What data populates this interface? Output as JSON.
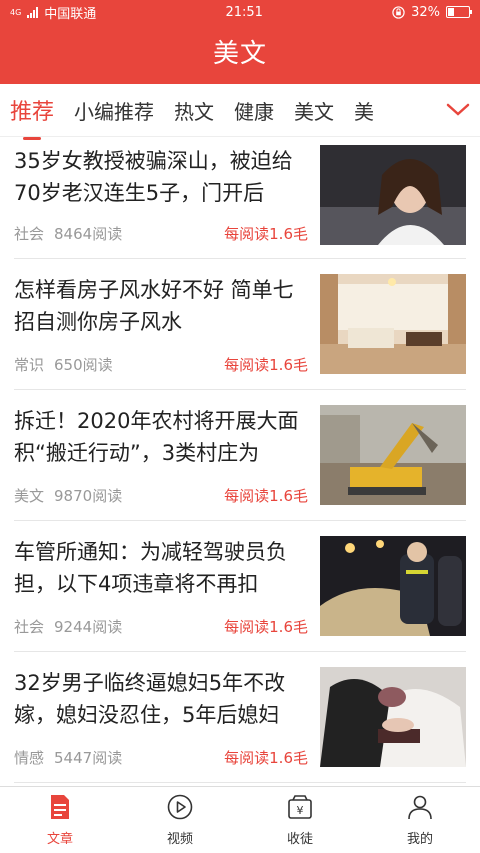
{
  "status": {
    "network_tag": "4G",
    "carrier": "中国联通",
    "time": "21:51",
    "battery_text": "32%",
    "battery_level": 0.32
  },
  "header": {
    "title": "美文"
  },
  "tabs": [
    {
      "label": "推荐",
      "active": true
    },
    {
      "label": "小编推荐"
    },
    {
      "label": "热文"
    },
    {
      "label": "健康"
    },
    {
      "label": "美文"
    },
    {
      "label": "美"
    }
  ],
  "articles": [
    {
      "title": "35岁女教授被骗深山，被迫给70岁老汉连生5子，门开后",
      "category": "社会",
      "reads": "8464阅读",
      "reward": "每阅读1.6毛"
    },
    {
      "title": "怎样看房子风水好不好 简单七招自测你房子风水",
      "category": "常识",
      "reads": "650阅读",
      "reward": "每阅读1.6毛"
    },
    {
      "title": "拆迁！2020年农村将开展大面积“搬迁行动”，3类村庄为",
      "category": "美文",
      "reads": "9870阅读",
      "reward": "每阅读1.6毛"
    },
    {
      "title": "车管所通知：为减轻驾驶员负担，以下4项违章将不再扣",
      "category": "社会",
      "reads": "9244阅读",
      "reward": "每阅读1.6毛"
    },
    {
      "title": "32岁男子临终逼媳妇5年不改嫁，媳妇没忍住，5年后媳妇",
      "category": "情感",
      "reads": "5447阅读",
      "reward": "每阅读1.6毛"
    }
  ],
  "bottom_nav": [
    {
      "label": "文章",
      "icon": "document-icon",
      "active": true
    },
    {
      "label": "视频",
      "icon": "play-icon"
    },
    {
      "label": "收徒",
      "icon": "wallet-icon"
    },
    {
      "label": "我的",
      "icon": "user-icon"
    }
  ],
  "colors": {
    "accent": "#e8453c"
  }
}
